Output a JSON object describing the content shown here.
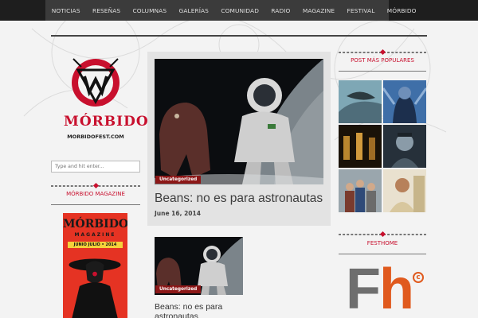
{
  "nav": {
    "items": [
      "NOTICIAS",
      "RESEÑAS",
      "COLUMNAS",
      "GALERÍAS",
      "COMUNIDAD",
      "RADIO",
      "MAGAZINE",
      "FESTIVAL",
      "MÓRBIDO"
    ]
  },
  "logo": {
    "text": "MÓRBIDO",
    "url": "MORBIDOFEST.COM"
  },
  "search": {
    "placeholder": "Type and hit enter..."
  },
  "left": {
    "magazine_title": "MÓRBIDO MAGAZINE",
    "magazine_cover": {
      "title": "MÓRBIDO",
      "subtitle": "MAGAZINE",
      "issue": "JUNIO JULIO • 2014"
    }
  },
  "featured": {
    "tag": "Uncategorized",
    "title": "Beans: no es para astronautas",
    "date": "June 16, 2014"
  },
  "small_post": {
    "tag": "Uncategorized",
    "title": "Beans: no es para astronautas"
  },
  "right": {
    "popular_title": "POST MÁS POPULARES",
    "festhome_title": "FESTHOME",
    "festhome_logo": {
      "f": "F",
      "h": "h",
      "mark": "c"
    }
  },
  "colors": {
    "accent": "#c8102e",
    "nav_bg": "#1e1e1e",
    "tag_bg": "#8c1717"
  }
}
